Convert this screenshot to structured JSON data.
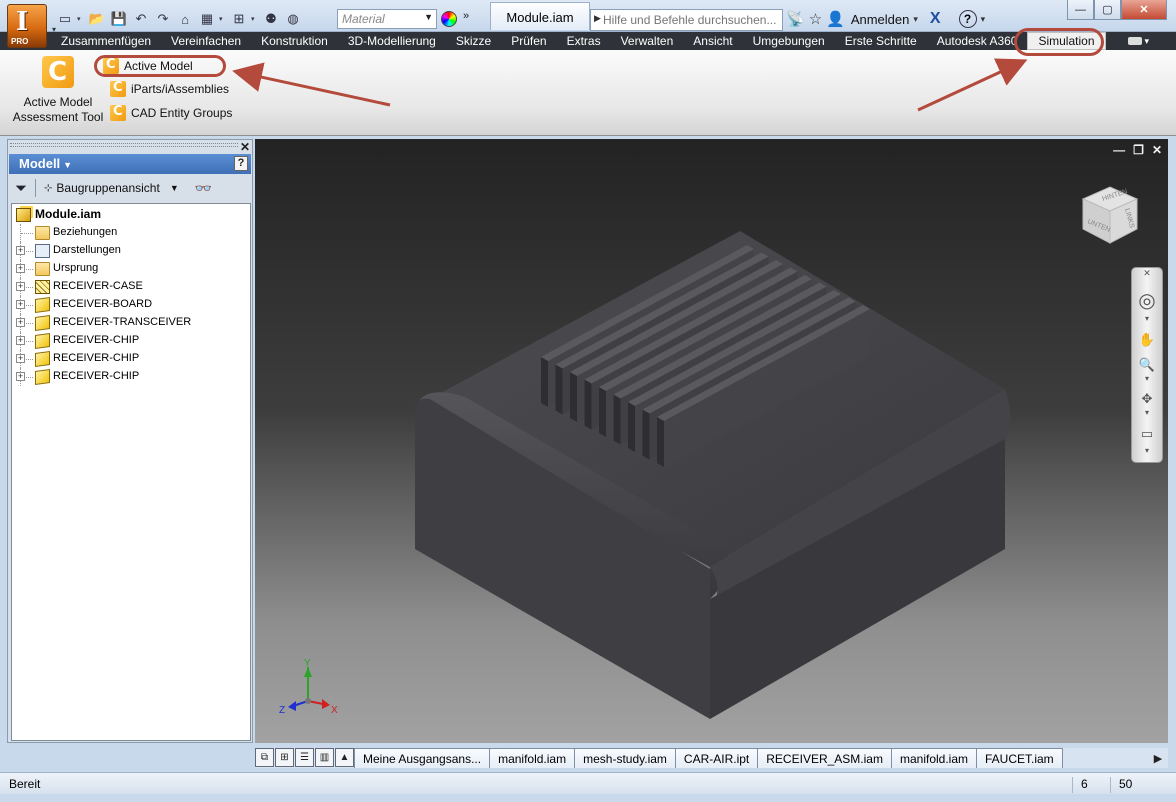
{
  "app": {
    "logo_letter": "I",
    "edition": "PRO",
    "document_title": "Module.iam"
  },
  "quick_access": {
    "material_placeholder": "Material"
  },
  "search": {
    "placeholder": "Hilfe und Befehle durchsuchen..."
  },
  "account": {
    "sign_in": "Anmelden"
  },
  "ribbon_tabs": [
    {
      "label": "Zusammenfügen"
    },
    {
      "label": "Vereinfachen"
    },
    {
      "label": "Konstruktion"
    },
    {
      "label": "3D-Modellierung"
    },
    {
      "label": "Skizze"
    },
    {
      "label": "Prüfen"
    },
    {
      "label": "Extras"
    },
    {
      "label": "Verwalten"
    },
    {
      "label": "Ansicht"
    },
    {
      "label": "Umgebungen"
    },
    {
      "label": "Erste Schritte"
    },
    {
      "label": "Autodesk A360"
    },
    {
      "label": "Simulation",
      "active": true
    }
  ],
  "ribbon": {
    "big_tool_line1": "Active Model",
    "big_tool_line2": "Assessment Tool",
    "small_tools": [
      "Active Model",
      "iParts/iAssemblies",
      "CAD Entity Groups"
    ]
  },
  "browser": {
    "title": "Modell",
    "view_mode": "Baugruppenansicht",
    "tree": [
      {
        "label": "Module.iam",
        "type": "root",
        "expandable": false
      },
      {
        "label": "Beziehungen",
        "type": "folder",
        "expandable": false
      },
      {
        "label": "Darstellungen",
        "type": "grid",
        "expandable": true
      },
      {
        "label": "Ursprung",
        "type": "folder",
        "expandable": true
      },
      {
        "label": "RECEIVER-CASE",
        "type": "case",
        "expandable": true
      },
      {
        "label": "RECEIVER-BOARD",
        "type": "part",
        "expandable": true
      },
      {
        "label": "RECEIVER-TRANSCEIVER",
        "type": "part",
        "expandable": true
      },
      {
        "label": "RECEIVER-CHIP",
        "type": "part",
        "expandable": true
      },
      {
        "label": "RECEIVER-CHIP",
        "type": "part",
        "expandable": true
      },
      {
        "label": "RECEIVER-CHIP",
        "type": "part",
        "expandable": true
      }
    ]
  },
  "viewcube": {
    "top_label": "HINTEN",
    "front_label": "UNTEN",
    "side_label": "LINKS"
  },
  "axes": {
    "x": "X",
    "y": "Y",
    "z": "Z"
  },
  "document_tabs": [
    "Meine Ausgangsans...",
    "manifold.iam",
    "mesh-study.iam",
    "CAR-AIR.ipt",
    "RECEIVER_ASM.iam",
    "manifold.iam",
    "FAUCET.iam"
  ],
  "status": {
    "text": "Bereit",
    "count_a": "6",
    "count_b": "50"
  },
  "colors": {
    "accent_orange": "#e07a1f",
    "annotation_red": "#b34a3c",
    "ribbon_tab_bar": "#2f3238",
    "browser_header": "#4a7cc4"
  }
}
